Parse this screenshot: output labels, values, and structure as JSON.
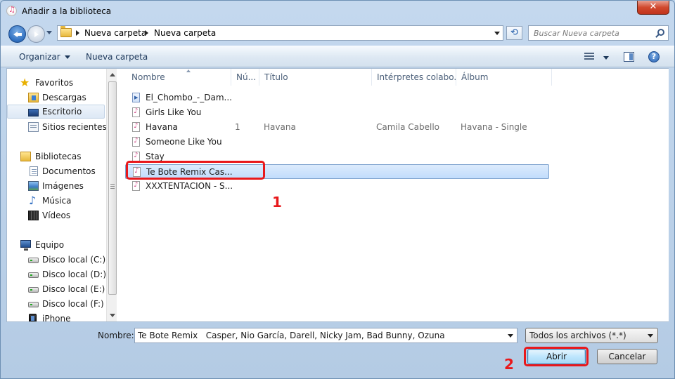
{
  "window": {
    "title": "Añadir a la biblioteca",
    "close_label": "✕"
  },
  "address": {
    "crumbs": [
      "Nueva carpeta",
      "Nueva carpeta"
    ],
    "search_placeholder": "Buscar Nueva carpeta"
  },
  "toolbar": {
    "organize_label": "Organizar",
    "new_folder_label": "Nueva carpeta"
  },
  "nav": {
    "favorites_label": "Favoritos",
    "favorites": [
      "Descargas",
      "Escritorio",
      "Sitios recientes"
    ],
    "libraries_label": "Bibliotecas",
    "libraries": [
      "Documentos",
      "Imágenes",
      "Música",
      "Vídeos"
    ],
    "computer_label": "Equipo",
    "computer": [
      "Disco local (C:)",
      "Disco local (D:)",
      "Disco local (E:)",
      "Disco local (F:)",
      "iPhone"
    ],
    "selected": "Escritorio"
  },
  "columns": [
    "Nombre",
    "Nú...",
    "Título",
    "Intérpretes colabo...",
    "Álbum"
  ],
  "files": [
    {
      "name": "El_Chombo_-_Dam...",
      "num": "",
      "title": "",
      "artist": "",
      "album": "",
      "type": "wma"
    },
    {
      "name": "Girls Like You",
      "num": "",
      "title": "",
      "artist": "",
      "album": "",
      "type": "m4a"
    },
    {
      "name": "Havana",
      "num": "1",
      "title": "Havana",
      "artist": "Camila Cabello",
      "album": "Havana - Single",
      "type": "m4a"
    },
    {
      "name": "Someone Like You",
      "num": "",
      "title": "",
      "artist": "",
      "album": "",
      "type": "m4a"
    },
    {
      "name": "Stay",
      "num": "",
      "title": "",
      "artist": "",
      "album": "",
      "type": "m4a"
    },
    {
      "name": "Te Bote Remix   Cas...",
      "num": "",
      "title": "",
      "artist": "",
      "album": "",
      "type": "m4a",
      "selected": true
    },
    {
      "name": "XXXTENTACION - S...",
      "num": "",
      "title": "",
      "artist": "",
      "album": "",
      "type": "m4a"
    }
  ],
  "annotations": {
    "step1": "1",
    "step2": "2",
    "color": "#e8181b"
  },
  "bottom": {
    "name_label": "Nombre:",
    "name_value": "Te Bote Remix   Casper, Nio García, Darell, Nicky Jam, Bad Bunny, Ozuna",
    "file_type": "Todos los archivos (*.*)",
    "open_label": "Abrir",
    "cancel_label": "Cancelar"
  },
  "icons": {
    "back": "back-arrow-icon",
    "forward": "forward-arrow-icon",
    "refresh": "refresh-icon",
    "search": "search-icon",
    "help": "help-icon"
  }
}
